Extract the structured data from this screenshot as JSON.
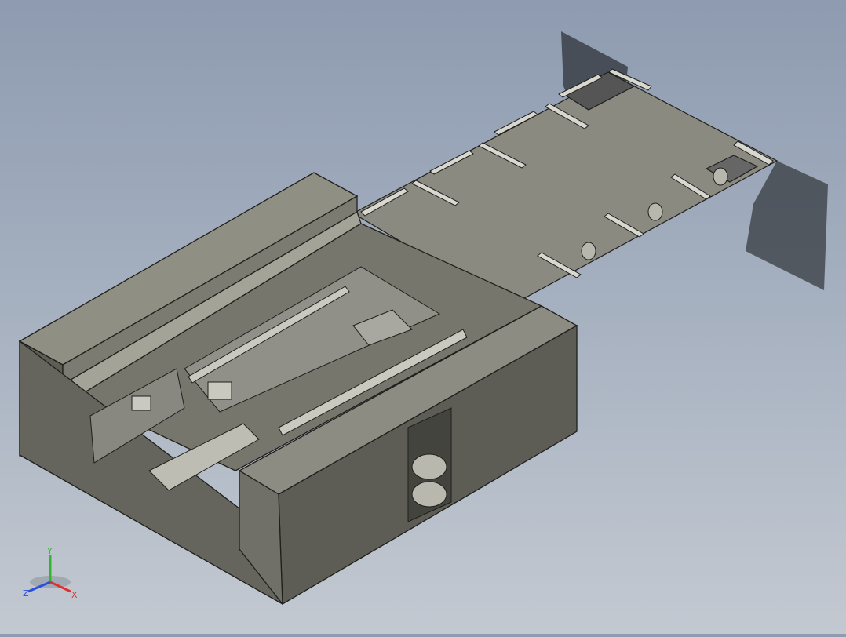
{
  "viewport": {
    "model_colors": {
      "body_top": "#8f8f84",
      "body_front": "#5d5d55",
      "body_side": "#6e6e65",
      "plate": "#8a8a81",
      "edge": "#1f1f1c",
      "rail": "#d8d8d0",
      "shadow": "#2f3338"
    }
  },
  "triad": {
    "x_label": "X",
    "y_label": "Y",
    "z_label": "Z",
    "x_color": "#e03131",
    "y_color": "#2fb82f",
    "z_color": "#2a4ee0"
  }
}
